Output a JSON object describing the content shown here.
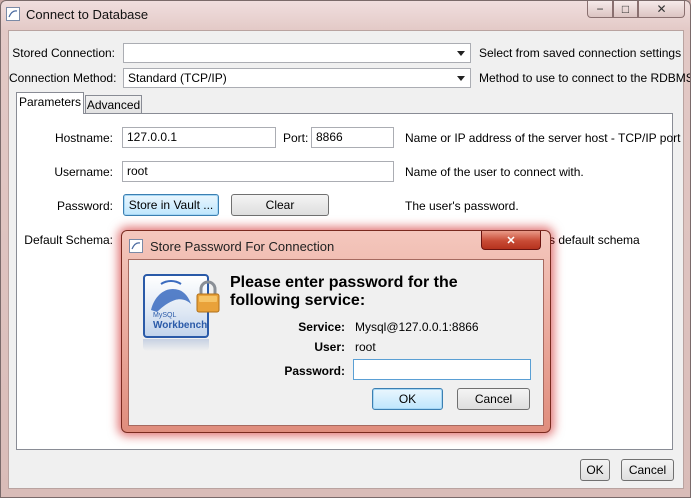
{
  "window": {
    "title": "Connect to Database",
    "ctrl_min": "−",
    "ctrl_max": "□",
    "ctrl_close": "✕"
  },
  "form": {
    "stored_connection_label": "Stored Connection:",
    "stored_connection_value": "",
    "stored_connection_help": "Select from saved connection settings",
    "method_label": "Connection Method:",
    "method_value": "Standard (TCP/IP)",
    "method_help": "Method to use to connect to the RDBMS"
  },
  "tabs": [
    {
      "label": "Parameters"
    },
    {
      "label": "Advanced"
    }
  ],
  "params": {
    "hostname_label": "Hostname:",
    "hostname_value": "127.0.0.1",
    "port_label": "Port:",
    "port_value": "8866",
    "hostname_help": "Name or IP address of the server host - TCP/IP port",
    "username_label": "Username:",
    "username_value": "root",
    "username_help": "Name of the user to connect with.",
    "password_label": "Password:",
    "store_vault_label": "Store in Vault ...",
    "clear_label": "Clear",
    "password_help": "The user's password.",
    "schema_label": "Default Schema:",
    "schema_help_partial": "s default schema"
  },
  "footer": {
    "ok_label": "OK",
    "cancel_label": "Cancel"
  },
  "dialog": {
    "title": "Store Password For Connection",
    "close_glyph": "✕",
    "heading_line1": "Please enter password for the",
    "heading_line2": "following service:",
    "service_label": "Service:",
    "service_value": "Mysql@127.0.0.1:8866",
    "user_label": "User:",
    "user_value": "root",
    "password_label": "Password:",
    "password_value": "",
    "ok_label": "OK",
    "cancel_label": "Cancel",
    "logo_text": "Workbench",
    "logo_small_text": "MySQL"
  }
}
